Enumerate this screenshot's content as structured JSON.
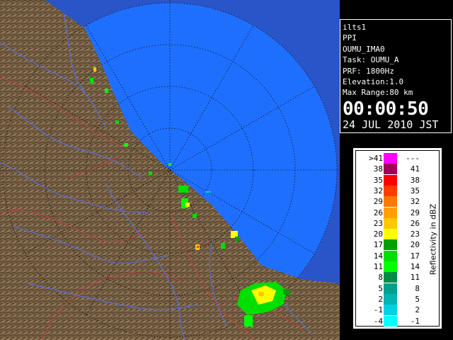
{
  "info": {
    "lines": [
      "ilts1",
      "PPI",
      "OUMU_IMA0",
      "Task: OUMU_A",
      "PRF: 1800Hz",
      "Elevation:1.0",
      "Max Range:80 km"
    ],
    "time": "00:00:50",
    "date": "24 JUL 2010 JST"
  },
  "legend": {
    "unit_label": "Reflectivity in dBZ",
    "rows": [
      {
        "min": ">41",
        "max": "---",
        "color": "#ff00ff"
      },
      {
        "min": "38",
        "max": "41",
        "color": "#a0005a"
      },
      {
        "min": "35",
        "max": "38",
        "color": "#ff0000"
      },
      {
        "min": "32",
        "max": "35",
        "color": "#ff3c00"
      },
      {
        "min": "29",
        "max": "32",
        "color": "#ff7800"
      },
      {
        "min": "26",
        "max": "29",
        "color": "#ffa000"
      },
      {
        "min": "23",
        "max": "26",
        "color": "#ffc800"
      },
      {
        "min": "20",
        "max": "23",
        "color": "#ffff00"
      },
      {
        "min": "17",
        "max": "20",
        "color": "#00a000"
      },
      {
        "min": "14",
        "max": "17",
        "color": "#00e000"
      },
      {
        "min": "11",
        "max": "14",
        "color": "#00ff00"
      },
      {
        "min": "8",
        "max": "11",
        "color": "#008c46"
      },
      {
        "min": "5",
        "max": "8",
        "color": "#00a08c"
      },
      {
        "min": "2",
        "max": "5",
        "color": "#00b4b4"
      },
      {
        "min": "-1",
        "max": "2",
        "color": "#00d2e6"
      },
      {
        "min": "-4",
        "max": "-1",
        "color": "#00ffff"
      }
    ]
  },
  "colors": {
    "sea": "#1f6fff",
    "sea_outer": "#2a55c8",
    "land": "#7a6246",
    "river": "#5a6fd8",
    "boundary": "#c04040"
  },
  "radar": {
    "range_rings_km": [
      20,
      40,
      60,
      80
    ]
  }
}
